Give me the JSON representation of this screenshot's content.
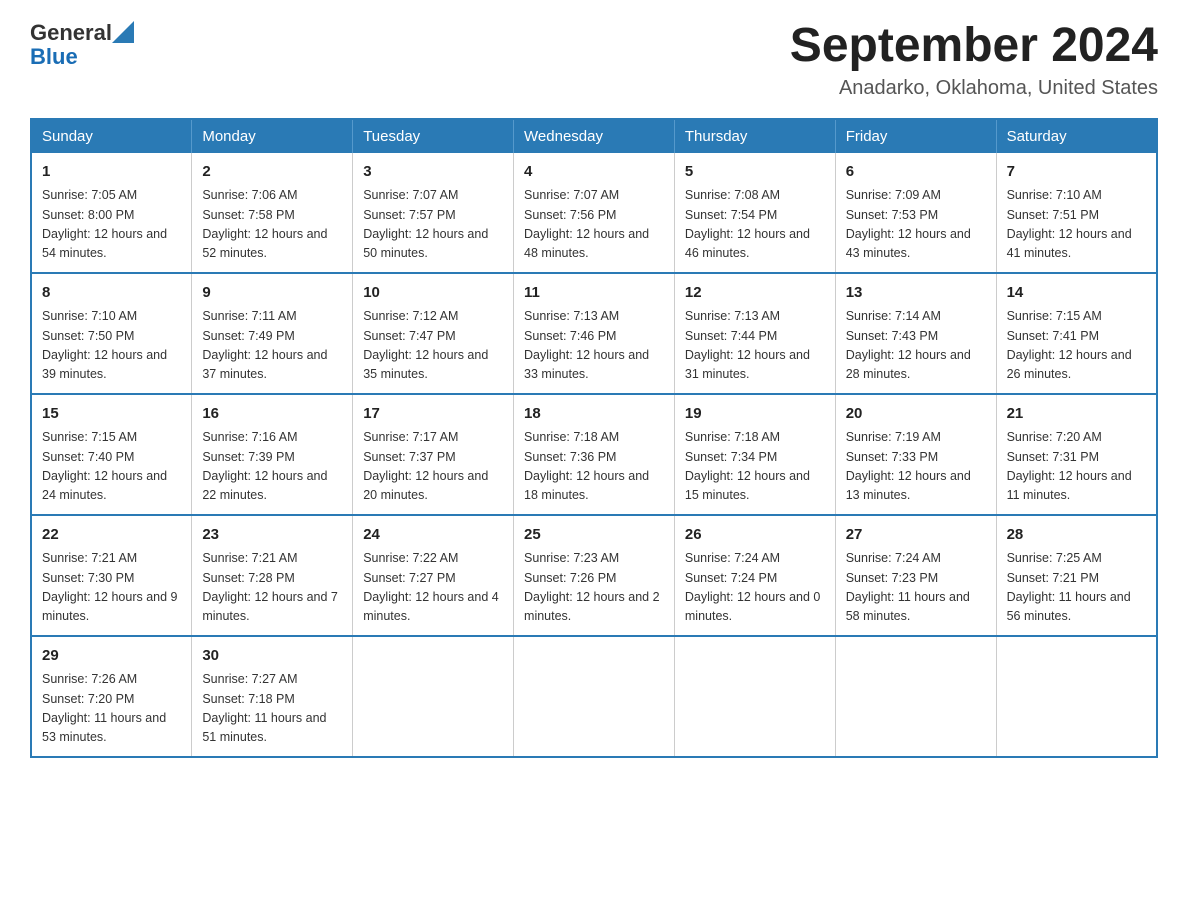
{
  "header": {
    "title": "September 2024",
    "subtitle": "Anadarko, Oklahoma, United States",
    "logo_general": "General",
    "logo_blue": "Blue"
  },
  "days_of_week": [
    "Sunday",
    "Monday",
    "Tuesday",
    "Wednesday",
    "Thursday",
    "Friday",
    "Saturday"
  ],
  "weeks": [
    [
      {
        "day": "1",
        "sunrise": "Sunrise: 7:05 AM",
        "sunset": "Sunset: 8:00 PM",
        "daylight": "Daylight: 12 hours and 54 minutes."
      },
      {
        "day": "2",
        "sunrise": "Sunrise: 7:06 AM",
        "sunset": "Sunset: 7:58 PM",
        "daylight": "Daylight: 12 hours and 52 minutes."
      },
      {
        "day": "3",
        "sunrise": "Sunrise: 7:07 AM",
        "sunset": "Sunset: 7:57 PM",
        "daylight": "Daylight: 12 hours and 50 minutes."
      },
      {
        "day": "4",
        "sunrise": "Sunrise: 7:07 AM",
        "sunset": "Sunset: 7:56 PM",
        "daylight": "Daylight: 12 hours and 48 minutes."
      },
      {
        "day": "5",
        "sunrise": "Sunrise: 7:08 AM",
        "sunset": "Sunset: 7:54 PM",
        "daylight": "Daylight: 12 hours and 46 minutes."
      },
      {
        "day": "6",
        "sunrise": "Sunrise: 7:09 AM",
        "sunset": "Sunset: 7:53 PM",
        "daylight": "Daylight: 12 hours and 43 minutes."
      },
      {
        "day": "7",
        "sunrise": "Sunrise: 7:10 AM",
        "sunset": "Sunset: 7:51 PM",
        "daylight": "Daylight: 12 hours and 41 minutes."
      }
    ],
    [
      {
        "day": "8",
        "sunrise": "Sunrise: 7:10 AM",
        "sunset": "Sunset: 7:50 PM",
        "daylight": "Daylight: 12 hours and 39 minutes."
      },
      {
        "day": "9",
        "sunrise": "Sunrise: 7:11 AM",
        "sunset": "Sunset: 7:49 PM",
        "daylight": "Daylight: 12 hours and 37 minutes."
      },
      {
        "day": "10",
        "sunrise": "Sunrise: 7:12 AM",
        "sunset": "Sunset: 7:47 PM",
        "daylight": "Daylight: 12 hours and 35 minutes."
      },
      {
        "day": "11",
        "sunrise": "Sunrise: 7:13 AM",
        "sunset": "Sunset: 7:46 PM",
        "daylight": "Daylight: 12 hours and 33 minutes."
      },
      {
        "day": "12",
        "sunrise": "Sunrise: 7:13 AM",
        "sunset": "Sunset: 7:44 PM",
        "daylight": "Daylight: 12 hours and 31 minutes."
      },
      {
        "day": "13",
        "sunrise": "Sunrise: 7:14 AM",
        "sunset": "Sunset: 7:43 PM",
        "daylight": "Daylight: 12 hours and 28 minutes."
      },
      {
        "day": "14",
        "sunrise": "Sunrise: 7:15 AM",
        "sunset": "Sunset: 7:41 PM",
        "daylight": "Daylight: 12 hours and 26 minutes."
      }
    ],
    [
      {
        "day": "15",
        "sunrise": "Sunrise: 7:15 AM",
        "sunset": "Sunset: 7:40 PM",
        "daylight": "Daylight: 12 hours and 24 minutes."
      },
      {
        "day": "16",
        "sunrise": "Sunrise: 7:16 AM",
        "sunset": "Sunset: 7:39 PM",
        "daylight": "Daylight: 12 hours and 22 minutes."
      },
      {
        "day": "17",
        "sunrise": "Sunrise: 7:17 AM",
        "sunset": "Sunset: 7:37 PM",
        "daylight": "Daylight: 12 hours and 20 minutes."
      },
      {
        "day": "18",
        "sunrise": "Sunrise: 7:18 AM",
        "sunset": "Sunset: 7:36 PM",
        "daylight": "Daylight: 12 hours and 18 minutes."
      },
      {
        "day": "19",
        "sunrise": "Sunrise: 7:18 AM",
        "sunset": "Sunset: 7:34 PM",
        "daylight": "Daylight: 12 hours and 15 minutes."
      },
      {
        "day": "20",
        "sunrise": "Sunrise: 7:19 AM",
        "sunset": "Sunset: 7:33 PM",
        "daylight": "Daylight: 12 hours and 13 minutes."
      },
      {
        "day": "21",
        "sunrise": "Sunrise: 7:20 AM",
        "sunset": "Sunset: 7:31 PM",
        "daylight": "Daylight: 12 hours and 11 minutes."
      }
    ],
    [
      {
        "day": "22",
        "sunrise": "Sunrise: 7:21 AM",
        "sunset": "Sunset: 7:30 PM",
        "daylight": "Daylight: 12 hours and 9 minutes."
      },
      {
        "day": "23",
        "sunrise": "Sunrise: 7:21 AM",
        "sunset": "Sunset: 7:28 PM",
        "daylight": "Daylight: 12 hours and 7 minutes."
      },
      {
        "day": "24",
        "sunrise": "Sunrise: 7:22 AM",
        "sunset": "Sunset: 7:27 PM",
        "daylight": "Daylight: 12 hours and 4 minutes."
      },
      {
        "day": "25",
        "sunrise": "Sunrise: 7:23 AM",
        "sunset": "Sunset: 7:26 PM",
        "daylight": "Daylight: 12 hours and 2 minutes."
      },
      {
        "day": "26",
        "sunrise": "Sunrise: 7:24 AM",
        "sunset": "Sunset: 7:24 PM",
        "daylight": "Daylight: 12 hours and 0 minutes."
      },
      {
        "day": "27",
        "sunrise": "Sunrise: 7:24 AM",
        "sunset": "Sunset: 7:23 PM",
        "daylight": "Daylight: 11 hours and 58 minutes."
      },
      {
        "day": "28",
        "sunrise": "Sunrise: 7:25 AM",
        "sunset": "Sunset: 7:21 PM",
        "daylight": "Daylight: 11 hours and 56 minutes."
      }
    ],
    [
      {
        "day": "29",
        "sunrise": "Sunrise: 7:26 AM",
        "sunset": "Sunset: 7:20 PM",
        "daylight": "Daylight: 11 hours and 53 minutes."
      },
      {
        "day": "30",
        "sunrise": "Sunrise: 7:27 AM",
        "sunset": "Sunset: 7:18 PM",
        "daylight": "Daylight: 11 hours and 51 minutes."
      },
      null,
      null,
      null,
      null,
      null
    ]
  ]
}
